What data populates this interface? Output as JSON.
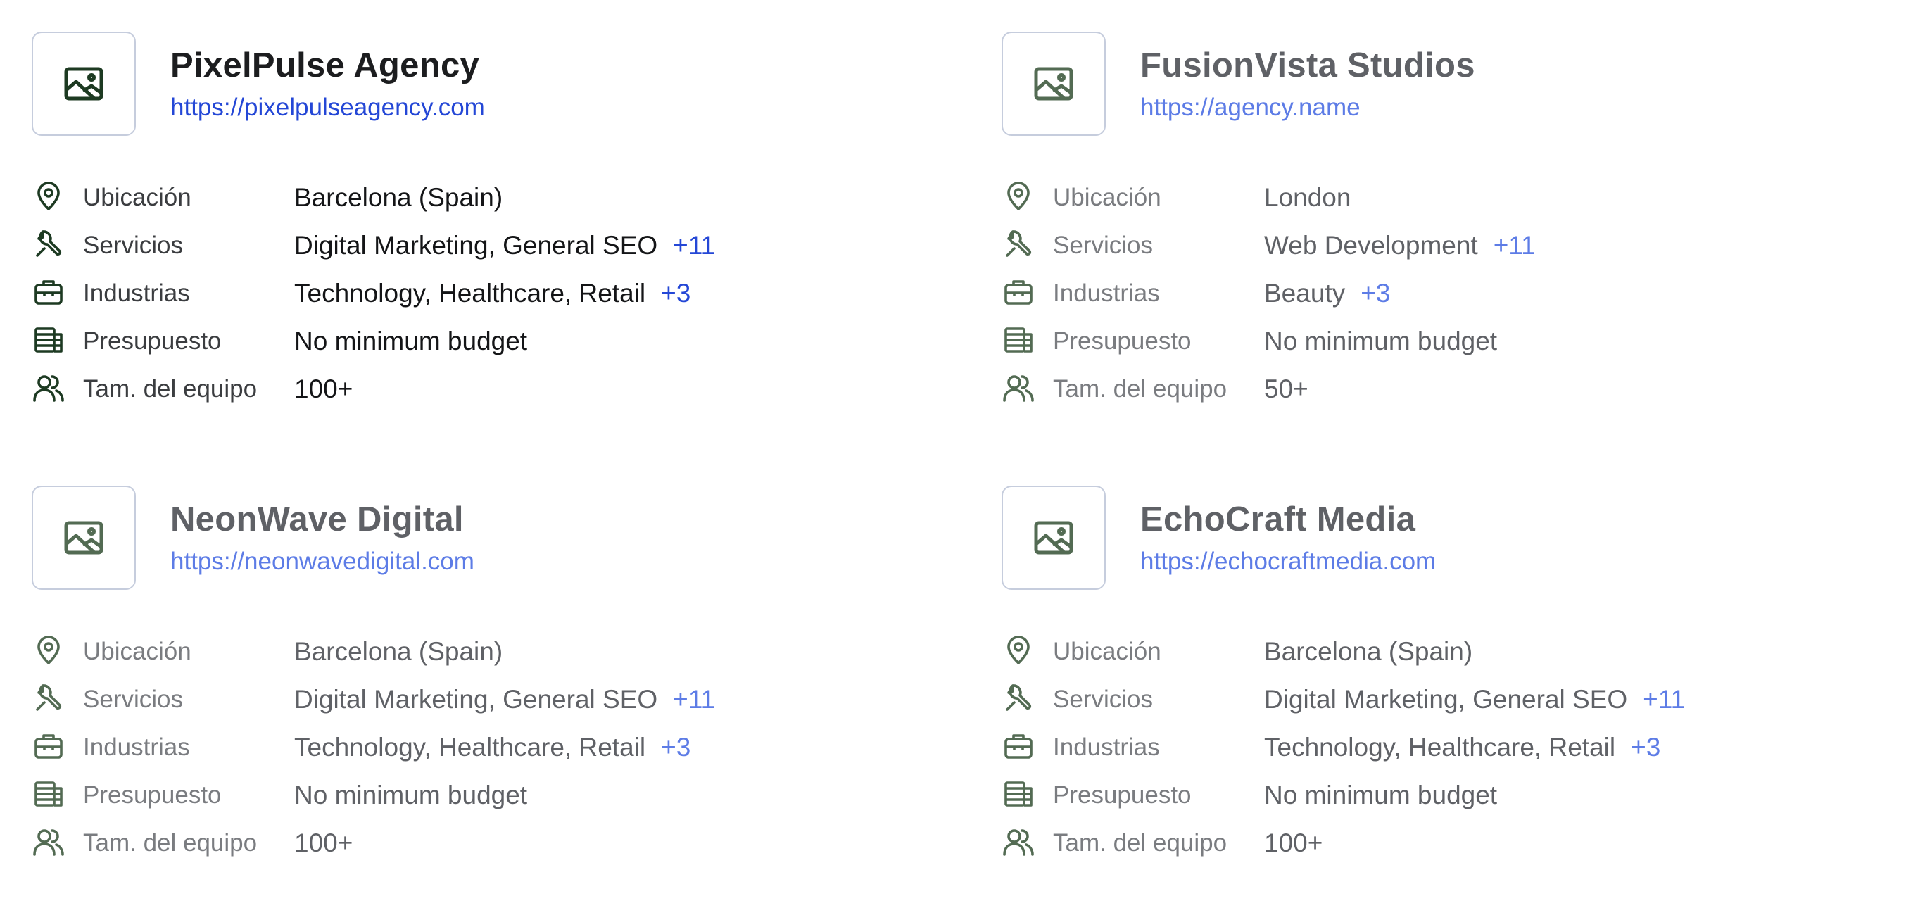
{
  "colors": {
    "icon_active": "#1d3a22",
    "icon_muted": "#536b53",
    "link_active": "#2447d6",
    "link_muted": "#5d7ce6",
    "logo_border": "#c6cddd"
  },
  "icons": {
    "logo": "image-placeholder-icon",
    "location": "map-pin-icon",
    "services": "wrench-icon",
    "industries": "briefcase-icon",
    "budget": "money-stack-icon",
    "team": "users-icon"
  },
  "agencies": [
    {
      "name": "PixelPulse Agency",
      "url": "https://pixelpulseagency.com",
      "active": true,
      "rows": [
        {
          "label": "Ubicación",
          "value": "Barcelona (Spain)",
          "more": ""
        },
        {
          "label": "Servicios",
          "value": "Digital Marketing, General SEO",
          "more": "+11"
        },
        {
          "label": "Industrias",
          "value": "Technology, Healthcare, Retail",
          "more": "+3"
        },
        {
          "label": "Presupuesto",
          "value": "No minimum budget",
          "more": ""
        },
        {
          "label": "Tam. del equipo",
          "value": "100+",
          "more": ""
        }
      ]
    },
    {
      "name": "FusionVista Studios",
      "url": "https://agency.name",
      "active": false,
      "rows": [
        {
          "label": "Ubicación",
          "value": "London",
          "more": ""
        },
        {
          "label": "Servicios",
          "value": "Web Development",
          "more": "+11"
        },
        {
          "label": "Industrias",
          "value": "Beauty",
          "more": "+3"
        },
        {
          "label": "Presupuesto",
          "value": "No minimum budget",
          "more": ""
        },
        {
          "label": "Tam. del equipo",
          "value": "50+",
          "more": ""
        }
      ]
    },
    {
      "name": "NeonWave Digital",
      "url": "https://neonwavedigital.com",
      "active": false,
      "rows": [
        {
          "label": "Ubicación",
          "value": "Barcelona (Spain)",
          "more": ""
        },
        {
          "label": "Servicios",
          "value": "Digital Marketing, General SEO",
          "more": "+11"
        },
        {
          "label": "Industrias",
          "value": "Technology, Healthcare, Retail",
          "more": "+3"
        },
        {
          "label": "Presupuesto",
          "value": "No minimum budget",
          "more": ""
        },
        {
          "label": "Tam. del equipo",
          "value": "100+",
          "more": ""
        }
      ]
    },
    {
      "name": "EchoCraft Media",
      "url": "https://echocraftmedia.com",
      "active": false,
      "rows": [
        {
          "label": "Ubicación",
          "value": "Barcelona (Spain)",
          "more": ""
        },
        {
          "label": "Servicios",
          "value": "Digital Marketing, General SEO",
          "more": "+11"
        },
        {
          "label": "Industrias",
          "value": "Technology, Healthcare, Retail",
          "more": "+3"
        },
        {
          "label": "Presupuesto",
          "value": "No minimum budget",
          "more": ""
        },
        {
          "label": "Tam. del equipo",
          "value": "100+",
          "more": ""
        }
      ]
    }
  ]
}
